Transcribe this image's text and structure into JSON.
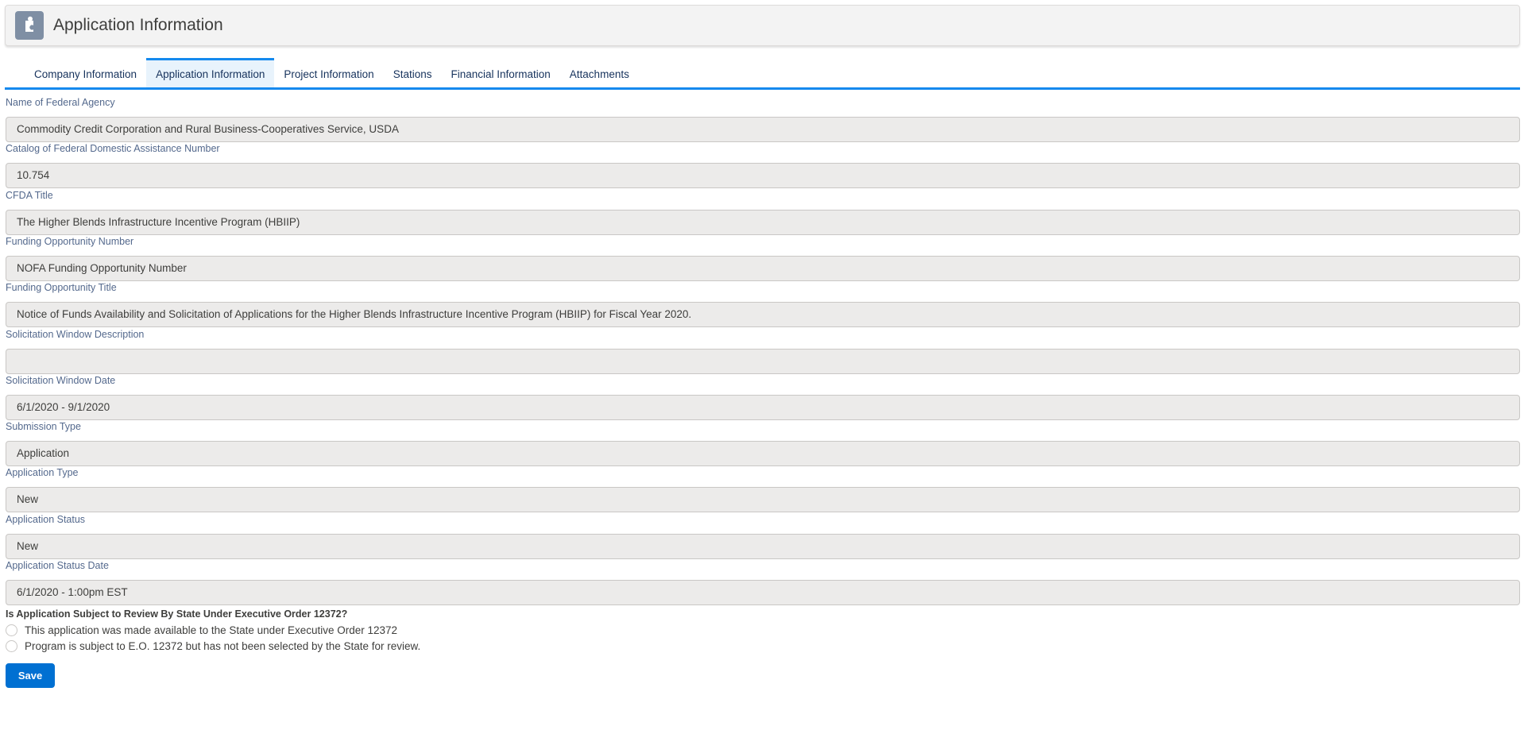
{
  "header": {
    "title": "Application Information",
    "icon": "puzzle-icon"
  },
  "tabs": [
    {
      "label": "Company Information"
    },
    {
      "label": "Application Information",
      "active": true
    },
    {
      "label": "Project Information"
    },
    {
      "label": "Stations"
    },
    {
      "label": "Financial Information"
    },
    {
      "label": "Attachments"
    }
  ],
  "fields": [
    {
      "label": "Name of Federal Agency",
      "value": "Commodity Credit Corporation and Rural Business-Cooperatives Service, USDA"
    },
    {
      "label": "Catalog of Federal Domestic Assistance Number",
      "value": "10.754"
    },
    {
      "label": "CFDA Title",
      "value": "The Higher Blends Infrastructure Incentive Program (HBIIP)"
    },
    {
      "label": "Funding Opportunity Number",
      "value": "NOFA Funding Opportunity Number"
    },
    {
      "label": "Funding Opportunity Title",
      "value": "Notice of Funds Availability and Solicitation of Applications for the Higher Blends Infrastructure Incentive Program (HBIIP) for Fiscal Year 2020."
    },
    {
      "label": "Solicitation Window Description",
      "value": ""
    },
    {
      "label": "Solicitation Window Date",
      "value": "6/1/2020 - 9/1/2020"
    },
    {
      "label": "Submission Type",
      "value": "Application"
    },
    {
      "label": "Application Type",
      "value": "New"
    },
    {
      "label": "Application Status",
      "value": "New"
    },
    {
      "label": "Application Status Date",
      "value": "6/1/2020 - 1:00pm EST"
    }
  ],
  "question": {
    "label": "Is Application Subject to Review By State Under Executive Order 12372?",
    "options": [
      "This application was made available to the State under Executive Order 12372",
      "Program is subject to E.O. 12372 but has not been selected by the State for review."
    ]
  },
  "save_label": "Save"
}
